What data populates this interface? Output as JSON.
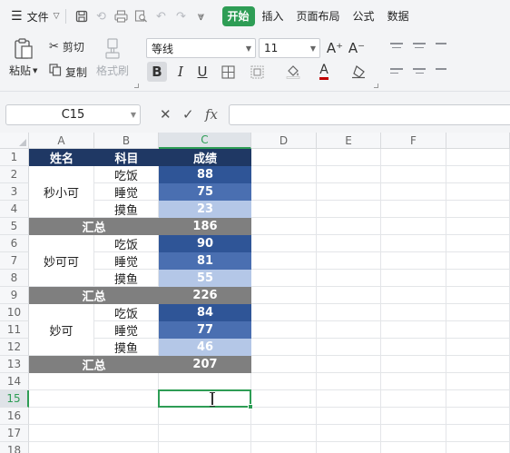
{
  "menu": {
    "file_label": "文件",
    "tabs": [
      "开始",
      "插入",
      "页面布局",
      "公式",
      "数据"
    ],
    "active_tab": "开始"
  },
  "ribbon": {
    "paste": "粘贴",
    "cut": "剪切",
    "copy": "复制",
    "format_painter": "格式刷",
    "font_name": "等线",
    "font_size": "11",
    "grow_font": "A⁺",
    "shrink_font": "A⁻",
    "bold": "B",
    "italic": "I",
    "underline": "U",
    "font_color": "A"
  },
  "formula_bar": {
    "name_box": "C15",
    "fx_label": "fx",
    "formula_value": ""
  },
  "columns": [
    "A",
    "B",
    "C",
    "D",
    "E",
    "F"
  ],
  "rows": [
    "1",
    "2",
    "3",
    "4",
    "5",
    "6",
    "7",
    "8",
    "9",
    "10",
    "11",
    "12",
    "13",
    "14",
    "15",
    "16",
    "17",
    "18"
  ],
  "selected_cell": {
    "col": "C",
    "row": "15"
  },
  "sheet": {
    "header": {
      "name": "姓名",
      "subject": "科目",
      "score": "成绩"
    },
    "groups": [
      {
        "name": "秒小可",
        "items": [
          {
            "subject": "吃饭",
            "score": "88"
          },
          {
            "subject": "睡觉",
            "score": "75"
          },
          {
            "subject": "摸鱼",
            "score": "23"
          }
        ],
        "total_label": "汇总",
        "total": "186"
      },
      {
        "name": "妙可可",
        "items": [
          {
            "subject": "吃饭",
            "score": "90"
          },
          {
            "subject": "睡觉",
            "score": "81"
          },
          {
            "subject": "摸鱼",
            "score": "55"
          }
        ],
        "total_label": "汇总",
        "total": "226"
      },
      {
        "name": "妙可",
        "items": [
          {
            "subject": "吃饭",
            "score": "84"
          },
          {
            "subject": "睡觉",
            "score": "77"
          },
          {
            "subject": "摸鱼",
            "score": "46"
          }
        ],
        "total_label": "汇总",
        "total": "207"
      }
    ]
  },
  "colors": {
    "accent": "#2e9d55",
    "header_fill": "#1f3864",
    "total_fill": "#7f7f7f",
    "score_dark": "#2f5597",
    "score_mid": "#4a6fb1",
    "score_light": "#b4c7e7"
  }
}
